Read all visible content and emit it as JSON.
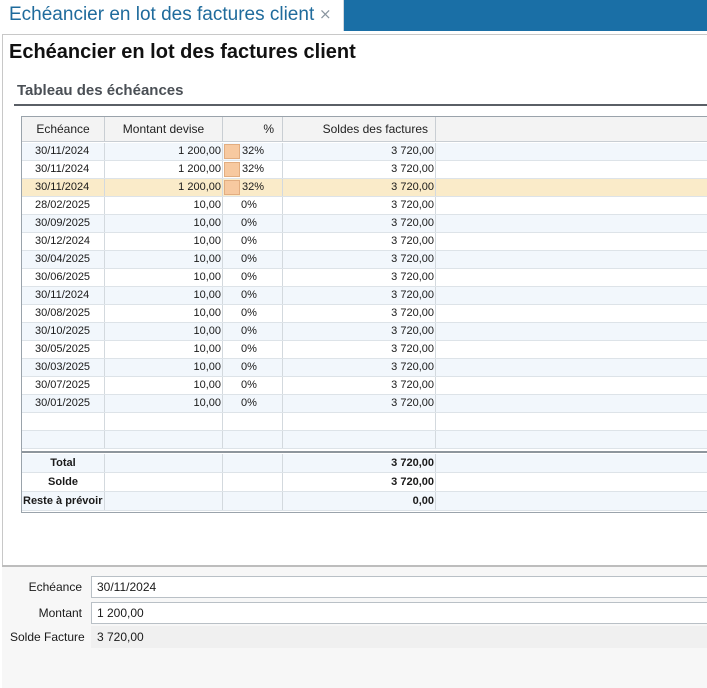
{
  "tab": {
    "label": "Echéancier en lot des factures client",
    "close": "×"
  },
  "page": {
    "title": "Echéancier en lot des factures client"
  },
  "section": {
    "title": "Tableau des échéances"
  },
  "table": {
    "columns": [
      "Echéance",
      "Montant devise",
      "%",
      "Soldes des factures"
    ],
    "rows": [
      {
        "date": "30/11/2024",
        "amount": "1 200,00",
        "pct": "32%",
        "balance": "3 720,00"
      },
      {
        "date": "30/11/2024",
        "amount": "1 200,00",
        "pct": "32%",
        "balance": "3 720,00"
      },
      {
        "date": "30/11/2024",
        "amount": "1 200,00",
        "pct": "32%",
        "balance": "3 720,00"
      },
      {
        "date": "28/02/2025",
        "amount": "10,00",
        "pct": "0%",
        "balance": "3 720,00"
      },
      {
        "date": "30/09/2025",
        "amount": "10,00",
        "pct": "0%",
        "balance": "3 720,00"
      },
      {
        "date": "30/12/2024",
        "amount": "10,00",
        "pct": "0%",
        "balance": "3 720,00"
      },
      {
        "date": "30/04/2025",
        "amount": "10,00",
        "pct": "0%",
        "balance": "3 720,00"
      },
      {
        "date": "30/06/2025",
        "amount": "10,00",
        "pct": "0%",
        "balance": "3 720,00"
      },
      {
        "date": "30/11/2024",
        "amount": "10,00",
        "pct": "0%",
        "balance": "3 720,00"
      },
      {
        "date": "30/08/2025",
        "amount": "10,00",
        "pct": "0%",
        "balance": "3 720,00"
      },
      {
        "date": "30/10/2025",
        "amount": "10,00",
        "pct": "0%",
        "balance": "3 720,00"
      },
      {
        "date": "30/05/2025",
        "amount": "10,00",
        "pct": "0%",
        "balance": "3 720,00"
      },
      {
        "date": "30/03/2025",
        "amount": "10,00",
        "pct": "0%",
        "balance": "3 720,00"
      },
      {
        "date": "30/07/2025",
        "amount": "10,00",
        "pct": "0%",
        "balance": "3 720,00"
      },
      {
        "date": "30/01/2025",
        "amount": "10,00",
        "pct": "0%",
        "balance": "3 720,00"
      }
    ],
    "totals": [
      {
        "label": "Total",
        "value": "3 720,00"
      },
      {
        "label": "Solde",
        "value": "3 720,00"
      },
      {
        "label": "Reste à prévoir",
        "value": "0,00"
      }
    ]
  },
  "form": {
    "echeance_label": "Echéance",
    "echeance_value": "30/11/2024",
    "montant_label": "Montant",
    "montant_value": "1 200,00",
    "solde_label": "Solde Facture",
    "solde_value": "3 720,00"
  },
  "colors": {
    "tabbar": "#1a6fa6",
    "selected_row": "#faebc9",
    "alt_row": "#f2f7fc",
    "pct_bar": "#f7c9a0"
  }
}
